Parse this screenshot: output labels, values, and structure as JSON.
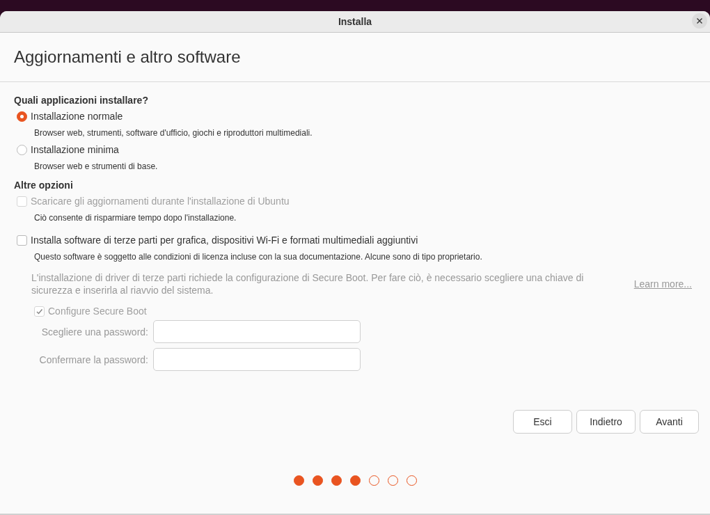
{
  "window": {
    "title": "Installa"
  },
  "page_title": "Aggiornamenti e altro software",
  "sections": [
    {
      "heading": "Quali applicazioni installare?",
      "options": [
        {
          "kind": "radio",
          "label": "Installazione normale",
          "description": "Browser web, strumenti, software d'ufficio, giochi e riproduttori multimediali.",
          "selected": true,
          "disabled": false
        },
        {
          "kind": "radio",
          "label": "Installazione minima",
          "description": "Browser web e strumenti di base.",
          "selected": false,
          "disabled": false
        }
      ]
    },
    {
      "heading": "Altre opzioni",
      "options": [
        {
          "kind": "checkbox",
          "label": "Scaricare gli aggiornamenti durante l'installazione di Ubuntu",
          "description": "Ciò consente di risparmiare tempo dopo l'installazione.",
          "checked": false,
          "disabled": true
        },
        {
          "kind": "checkbox",
          "label": "Installa software di terze parti per grafica, dispositivi Wi-Fi e formati multimediali aggiuntivi",
          "description": "Questo software è soggetto alle condizioni di licenza incluse con la sua documentazione. Alcune sono di tipo proprietario.",
          "checked": false,
          "disabled": false
        }
      ]
    }
  ],
  "secure_boot": {
    "note": "L'installazione di driver di terze parti richiede la configurazione di Secure Boot. Per fare ciò, è necessario scegliere una chiave di sicurezza e inserirla al riavvio del sistema.",
    "link": "Learn more...",
    "option": {
      "label": "Configure Secure Boot",
      "checked": true,
      "disabled": true
    },
    "fields": [
      {
        "label": "Scegliere una password:"
      },
      {
        "label": "Confermare la password:"
      }
    ]
  },
  "buttons": [
    "Esci",
    "Indietro",
    "Avanti"
  ],
  "progress": [
    {
      "completed": true
    },
    {
      "completed": true
    },
    {
      "completed": true
    },
    {
      "completed": true
    },
    {
      "completed": false
    },
    {
      "completed": false
    },
    {
      "completed": false
    }
  ]
}
